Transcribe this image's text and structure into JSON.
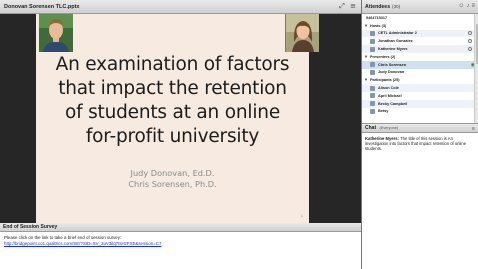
{
  "presentation": {
    "file_title": "Donovan Sorensen TLC.pptx",
    "slide": {
      "title_lines": [
        "An examination of factors",
        "that impact the retention",
        "of students at an online",
        "for-profit university"
      ],
      "authors": [
        "Judy Donovan, Ed.D.",
        "Chris Sorensen, Ph.D."
      ],
      "slide_number": "1"
    }
  },
  "survey": {
    "title": "End of Session Survey",
    "text": "Please click on the link to take a brief end of session survey:",
    "link": "http://bridgepoint.co1.qualtrics.com/SE/?SID=SV_3uV3ilq7tsHzFXE&session=C7"
  },
  "attendees": {
    "title": "Attendees",
    "count": "(30)",
    "me": "9464715317",
    "groups": [
      {
        "label": "Hosts (3)",
        "members": [
          "CETL Administrator 2",
          "Jonathan Gonzalez",
          "Katherine Myers"
        ]
      },
      {
        "label": "Presenters (2)",
        "members": [
          "Chris Sorensen",
          "Judy Donovan"
        ]
      },
      {
        "label": "Participants (25)",
        "members": [
          "Alison Cole",
          "April Michael",
          "Becky Campbell",
          "Betsy"
        ]
      }
    ]
  },
  "chat": {
    "title": "Chat",
    "scope": "(Everyone)",
    "messages": [
      {
        "name": "Katherine Myers:",
        "text": "The title of this session is An investigation into factors that impact retention of online students."
      }
    ]
  },
  "colors": {
    "slide_bg": "#f7ebe1",
    "link": "#1a33cc",
    "highlight": "#cfe0f2"
  }
}
